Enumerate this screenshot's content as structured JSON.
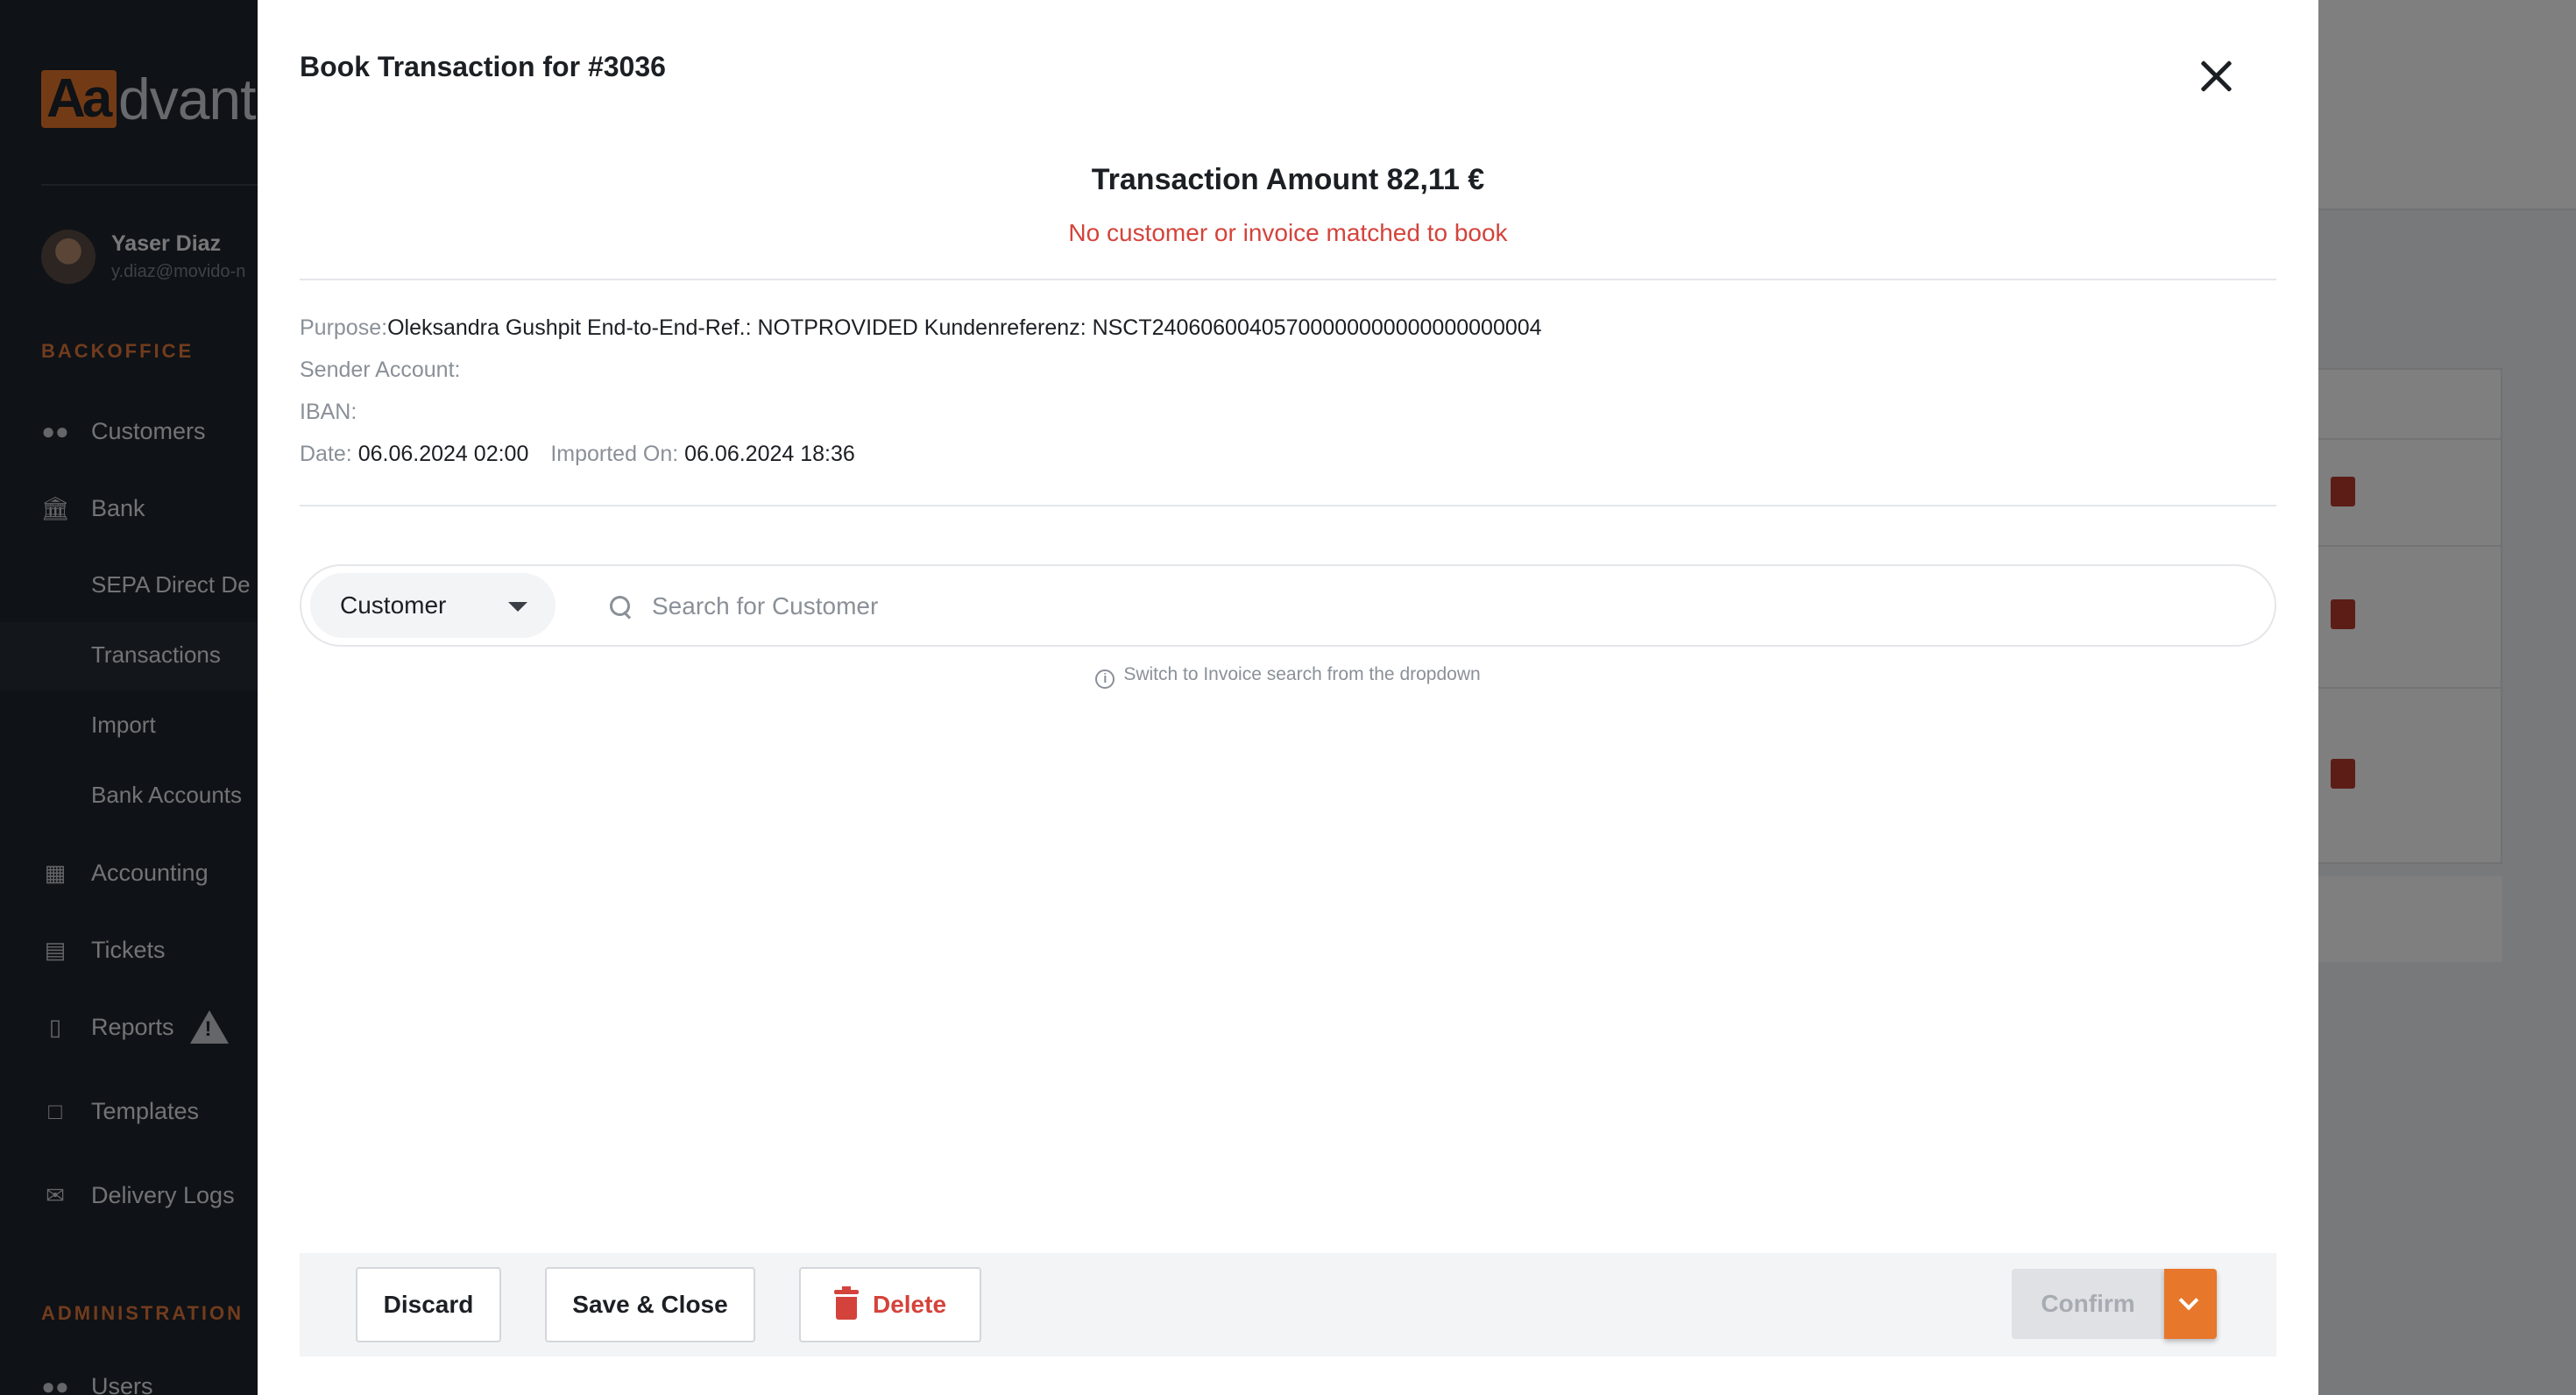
{
  "sidebar": {
    "logo": {
      "box": "Aa",
      "rest": "dvanto"
    },
    "user": {
      "name": "Yaser Diaz",
      "email": "y.diaz@movido-n"
    },
    "sections": {
      "backoffice": "BACKOFFICE",
      "administration": "ADMINISTRATION"
    },
    "items": {
      "customers": "Customers",
      "bank": "Bank",
      "sepa": "SEPA Direct De",
      "transactions": "Transactions",
      "import": "Import",
      "bank_accounts": "Bank Accounts",
      "accounting": "Accounting",
      "tickets": "Tickets",
      "reports": "Reports",
      "templates": "Templates",
      "delivery_logs": "Delivery Logs",
      "users": "Users"
    }
  },
  "modal": {
    "title": "Book Transaction for #3036",
    "amount": "Transaction Amount 82,11 €",
    "warning": "No customer or invoice matched to book",
    "purpose_label": "Purpose:",
    "purpose_value": "Oleksandra Gushpit End-to-End-Ref.: NOTPROVIDED Kundenreferenz: NSCT24060600405700000000000000000004",
    "sender_label": "Sender Account:",
    "iban_label": "IBAN:",
    "date_label": "Date:",
    "date_value": "06.06.2024 02:00",
    "imported_label": "Imported On:",
    "imported_value": "06.06.2024 18:36",
    "search": {
      "type": "Customer",
      "placeholder": "Search for Customer",
      "hint": "Switch to Invoice search from the dropdown"
    },
    "footer": {
      "discard": "Discard",
      "save_close": "Save & Close",
      "delete": "Delete",
      "confirm": "Confirm"
    }
  },
  "colors": {
    "accent": "#e7772b",
    "danger": "#d4433b",
    "sidebar_bg": "#1f252d"
  }
}
